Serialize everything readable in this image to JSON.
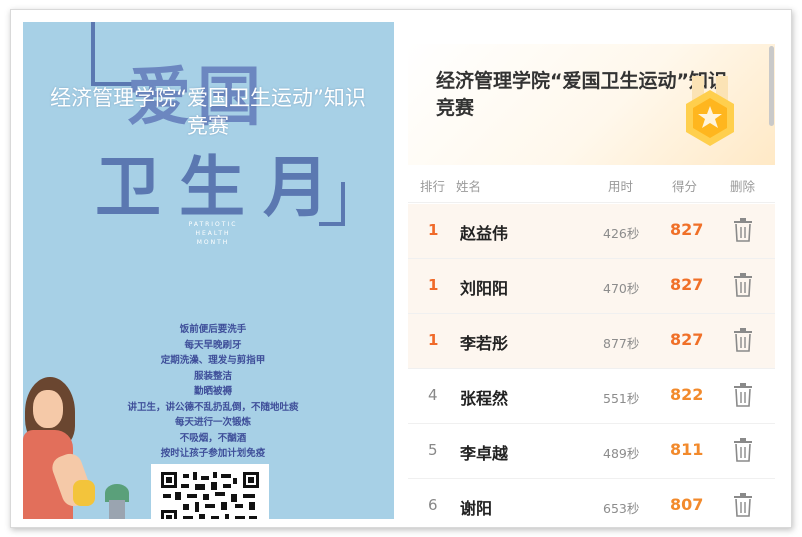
{
  "poster": {
    "big_line1": "爱国",
    "big_line2": "卫生月",
    "overlay_title": "经济管理学院“爱国卫生运动”知识竞赛",
    "english": "PATRIOTIC HEALTH MONTH",
    "tips": [
      "饭前便后要洗手",
      "每天早晚刷牙",
      "定期洗澡、理发与剪指甲",
      "服装整洁",
      "勤晒被褥",
      "讲卫生，讲公德不乱扔乱倒，不随地吐痰",
      "每天进行一次锻炼",
      "不吸烟，不酗酒",
      "按时让孩子参加计划免疫"
    ]
  },
  "leaderboard": {
    "title": "经济管理学院“爱国卫生运动”知识竞赛",
    "columns": {
      "rank": "排行",
      "name": "姓名",
      "time": "用时",
      "score": "得分",
      "delete": "删除"
    },
    "rows": [
      {
        "rank": "1",
        "name": "赵益伟",
        "time": "426秒",
        "score": "827",
        "top": true
      },
      {
        "rank": "1",
        "name": "刘阳阳",
        "time": "470秒",
        "score": "827",
        "top": true
      },
      {
        "rank": "1",
        "name": "李若彤",
        "time": "877秒",
        "score": "827",
        "top": true
      },
      {
        "rank": "4",
        "name": "张程然",
        "time": "551秒",
        "score": "822",
        "top": false
      },
      {
        "rank": "5",
        "name": "李卓越",
        "time": "489秒",
        "score": "811",
        "top": false
      },
      {
        "rank": "6",
        "name": "谢阳",
        "time": "653秒",
        "score": "807",
        "top": false
      }
    ]
  },
  "icons": {
    "badge": "star-medal-icon",
    "delete": "trash-icon"
  },
  "colors": {
    "accent": "#f07028",
    "poster_bg": "#a7d0e6",
    "poster_text": "#5b78b1"
  }
}
